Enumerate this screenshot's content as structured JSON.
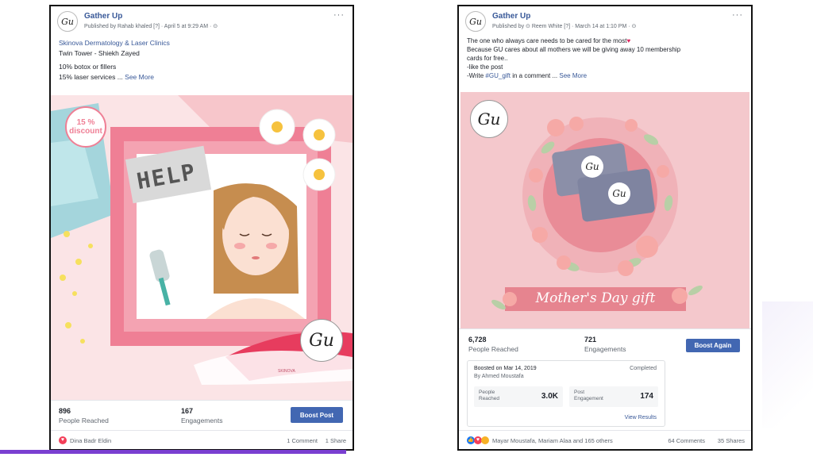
{
  "left_post": {
    "page_name": "Gather Up",
    "logo_text": "Gu",
    "meta": "Published by Rahab khaled [?] · April 5 at 9:29 AM · ⊙",
    "more": "···",
    "clinic_link": "Skinova Dermatology & Laser Clinics",
    "location": "Twin Tower - Shiekh Zayed",
    "line1": "10% botox or fillers",
    "line2": "15% laser services ...",
    "see_more": "See More",
    "image": {
      "discount": "15 %\ndiscount",
      "sign": "HELP",
      "logo": "Gu",
      "brand_small": "SKINOVA"
    },
    "stats": {
      "reached_num": "896",
      "reached_label": "People Reached",
      "engagements_num": "167",
      "engagements_label": "Engagements",
      "boost_label": "Boost Post"
    },
    "footer": {
      "liker": "Dina Badr Eldin",
      "comments": "1 Comment",
      "shares": "1 Share"
    }
  },
  "right_post": {
    "page_name": "Gather Up",
    "logo_text": "Gu",
    "meta": "Published by ⊙ Reem White [?] · March 14 at 1:10 PM · ⊙",
    "more": "···",
    "line1": "The one who always care needs to be cared for the most",
    "line2": "Because GU cares about all mothers we will be giving away 10 membership",
    "line3": "cards for free..",
    "line4": "-like the post",
    "line5_prefix": "-Write",
    "hashtag": "#GU_gift",
    "line5_suffix": "in a comment ...",
    "see_more": "See More",
    "image": {
      "logo": "Gu",
      "card_logo": "Gu",
      "banner": "Mother's Day gift"
    },
    "stats": {
      "reached_num": "6,728",
      "reached_label": "People Reached",
      "engagements_num": "721",
      "engagements_label": "Engagements",
      "boost_label": "Boost Again"
    },
    "boosted": {
      "title": "Boosted on Mar 14, 2019",
      "by": "By Ahmed Moustafa",
      "status": "Completed",
      "people_label": "People\nReached",
      "people_value": "3.0K",
      "post_label": "Post\nEngagement",
      "post_value": "174",
      "view_results": "View Results"
    },
    "footer": {
      "likers": "Mayar Moustafa, Mariam Alaa and 165 others",
      "comments": "64 Comments",
      "shares": "35 Shares"
    }
  },
  "colors": {
    "facebook_blue": "#4267b2",
    "link_blue": "#385898",
    "pink": "#f4c8cc",
    "frame_pink": "#ef7f95",
    "purple_bar": "#7a3fd1"
  }
}
